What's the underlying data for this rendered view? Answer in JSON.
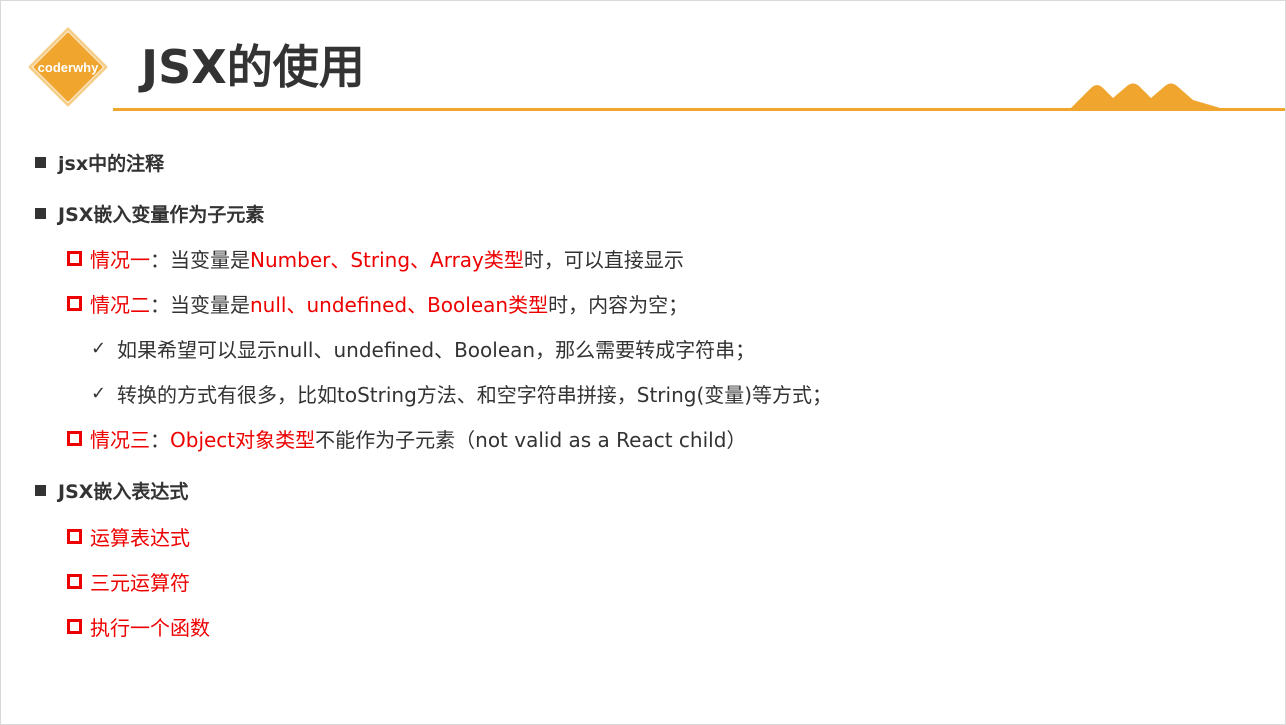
{
  "header": {
    "logo_text": "coderwhy",
    "title": "JSX的使用",
    "accent_color": "#efa52e"
  },
  "content": {
    "items": [
      {
        "level": 1,
        "text": "jsx中的注释"
      },
      {
        "level": 1,
        "text": "JSX嵌入变量作为子元素"
      },
      {
        "level": 2,
        "label": "情况一",
        "separator": "：当变量是",
        "highlight": "Number、String、Array类型",
        "rest": "时，可以直接显示"
      },
      {
        "level": 2,
        "label": "情况二",
        "separator": "：当变量是",
        "highlight": "null、undefined、Boolean类型",
        "rest": "时，内容为空；"
      },
      {
        "level": 3,
        "text": "如果希望可以显示null、undefined、Boolean，那么需要转成字符串；"
      },
      {
        "level": 3,
        "text": "转换的方式有很多，比如toString方法、和空字符串拼接，String(变量)等方式；"
      },
      {
        "level": 2,
        "label": "情况三",
        "separator": "：",
        "highlight": "Object对象类型",
        "rest": "不能作为子元素（not valid as a React child）"
      },
      {
        "level": 1,
        "text": "JSX嵌入表达式"
      },
      {
        "level": 2,
        "label": "运算表达式"
      },
      {
        "level": 2,
        "label": "三元运算符"
      },
      {
        "level": 2,
        "label": "执行一个函数"
      }
    ]
  },
  "colors": {
    "bullet_level1": "#333333",
    "bullet_level2": "#ee0000",
    "highlight": "#ee0000"
  },
  "icons": {
    "level1_bullet": "black-square-icon",
    "level2_bullet": "red-hollow-square-icon",
    "level3_bullet": "checkmark-icon",
    "decoration": "mountain-peaks-icon"
  }
}
